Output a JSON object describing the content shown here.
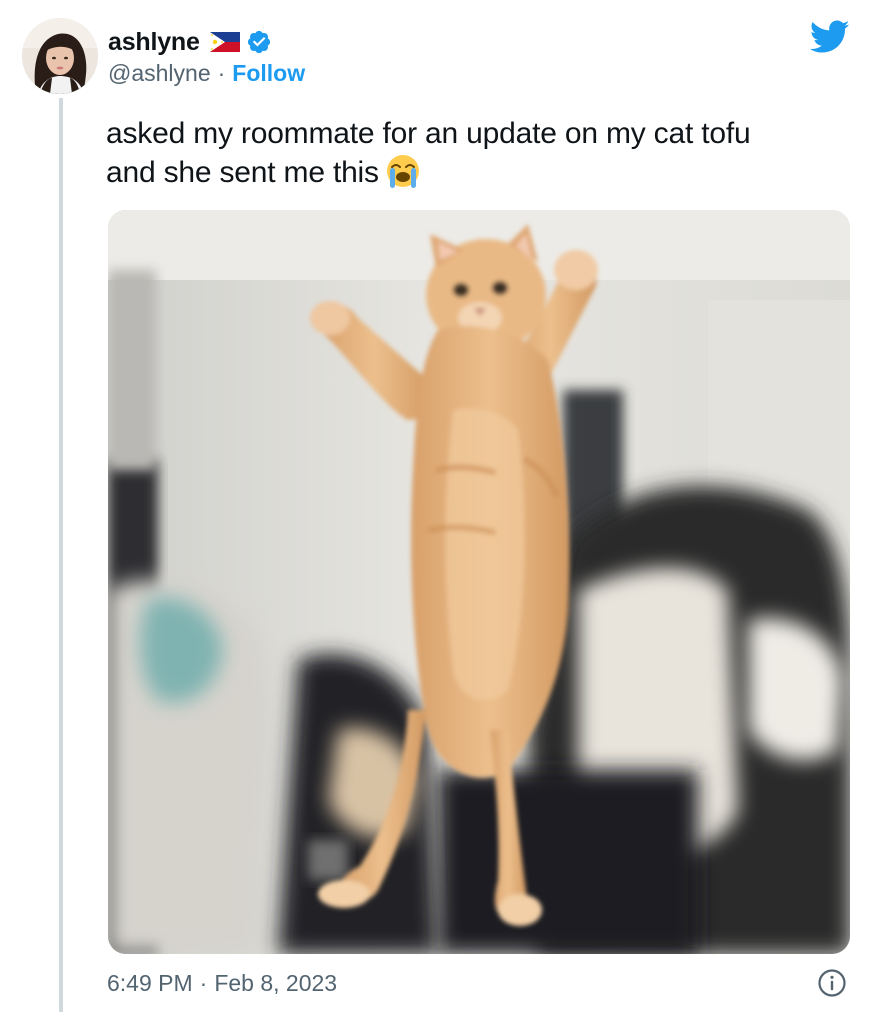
{
  "tweet": {
    "display_name": "ashlyne",
    "flag_icon": "philippines-flag-icon",
    "verified_icon": "verified-badge-icon",
    "handle": "@ashlyne",
    "separator": "·",
    "follow_label": "Follow",
    "text_line1": "asked my roommate for an update on my cat tofu",
    "text_line2": "and she sent me this",
    "emoji_icon": "loudly-crying-face-emoji",
    "media_icon": "cat-photo",
    "time": "6:49 PM",
    "meta_separator": "·",
    "date": "Feb 8, 2023"
  },
  "icons": {
    "brand": "twitter-bird-icon",
    "info": "info-icon"
  },
  "colors": {
    "accent": "#1d9bf0",
    "text_primary": "#0f1419",
    "text_secondary": "#536471",
    "thread_line": "#cfd9de"
  }
}
